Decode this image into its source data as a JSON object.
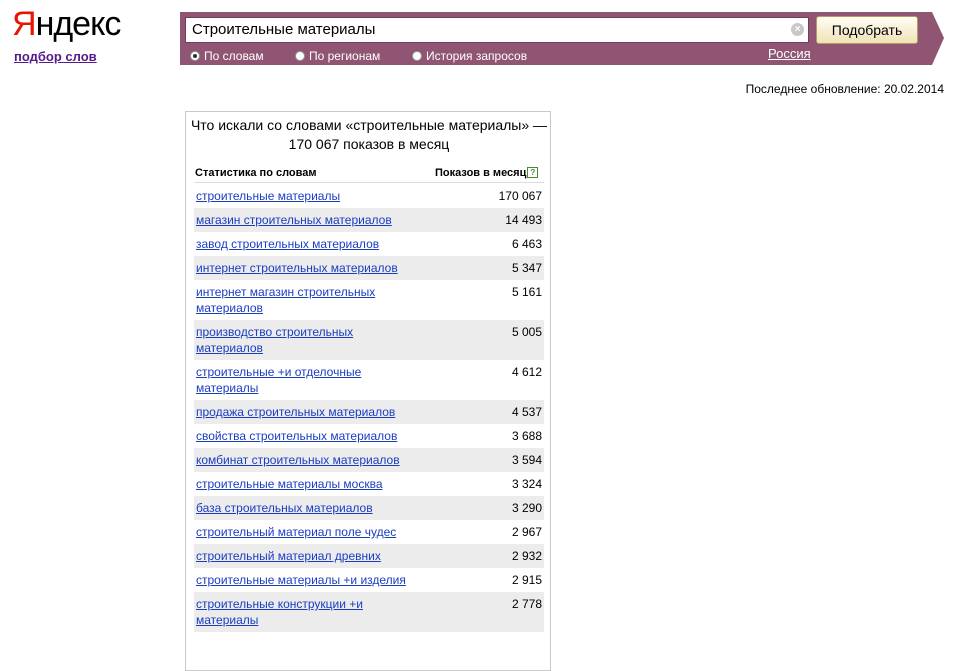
{
  "header": {
    "logo_first": "Я",
    "logo_rest": "ндекс",
    "service_link": "подбор слов"
  },
  "search": {
    "query": "Строительные материалы",
    "button_label": "Подобрать",
    "modes": [
      {
        "label": "По словам",
        "checked": true
      },
      {
        "label": "По регионам",
        "checked": false
      },
      {
        "label": "История запросов",
        "checked": false
      }
    ],
    "region": "Россия"
  },
  "last_update": "Последнее обновление: 20.02.2014",
  "stats": {
    "title": "Что искали со словами «строительные материалы» — 170 067 показов в месяц",
    "col_words": "Статистика по словам",
    "col_count": "Показов в месяц",
    "help": "?",
    "rows": [
      {
        "phrase": "строительные материалы",
        "count": "170 067"
      },
      {
        "phrase": "магазин строительных материалов",
        "count": "14 493"
      },
      {
        "phrase": "завод строительных материалов",
        "count": "6 463"
      },
      {
        "phrase": "интернет строительных материалов",
        "count": "5 347"
      },
      {
        "phrase": "интернет магазин строительных материалов",
        "count": "5 161"
      },
      {
        "phrase": "производство строительных материалов",
        "count": "5 005"
      },
      {
        "phrase": "строительные +и отделочные материалы",
        "count": "4 612"
      },
      {
        "phrase": "продажа строительных материалов",
        "count": "4 537"
      },
      {
        "phrase": "свойства строительных материалов",
        "count": "3 688"
      },
      {
        "phrase": "комбинат строительных материалов",
        "count": "3 594"
      },
      {
        "phrase": "строительные материалы москва",
        "count": "3 324"
      },
      {
        "phrase": "база строительных материалов",
        "count": "3 290"
      },
      {
        "phrase": "строительный материал поле чудес",
        "count": "2 967"
      },
      {
        "phrase": "строительный материал древних",
        "count": "2 932"
      },
      {
        "phrase": "строительные материалы +и изделия",
        "count": "2 915"
      },
      {
        "phrase": "строительные конструкции +и материалы",
        "count": "2 778"
      }
    ]
  }
}
